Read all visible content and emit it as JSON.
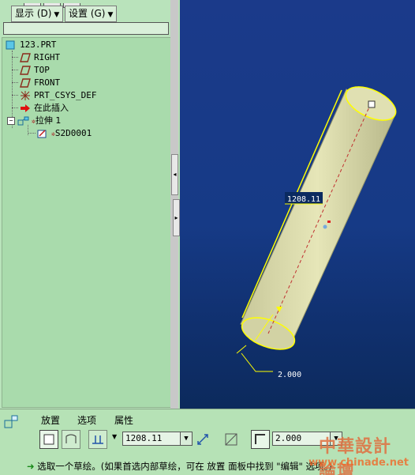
{
  "menubar": {
    "display": "显示 (D)",
    "settings": "设置 (G)"
  },
  "tree": {
    "root": "123.PRT",
    "items": [
      {
        "label": "RIGHT",
        "icon": "datum-plane-icon"
      },
      {
        "label": "TOP",
        "icon": "datum-plane-icon"
      },
      {
        "label": "FRONT",
        "icon": "datum-plane-icon"
      },
      {
        "label": "PRT_CSYS_DEF",
        "icon": "csys-icon"
      },
      {
        "label": "在此插入",
        "icon": "insert-here-arrow-icon"
      },
      {
        "label": "拉伸 1",
        "icon": "extrude-icon"
      },
      {
        "label": "S2D0001",
        "icon": "sketch-icon"
      }
    ]
  },
  "viewport": {
    "depth_label": "1208.11",
    "thickness_label": "2.000"
  },
  "dashboard": {
    "tabs": {
      "placement": "放置",
      "options": "选项",
      "properties": "属性"
    },
    "depth_value": "1208.11",
    "thickness_value": "2.000",
    "message": "选取一个草绘。(如果首选内部草绘，可在 放置 面板中找到 \"编辑\" 选项。)"
  },
  "watermark": {
    "line1": "中華設計論壇",
    "line2": "www.chinade.net"
  },
  "colors": {
    "tree_bg": "#a9dbac",
    "viewport_bg": "#163a86",
    "cylinder": "#d9d9a6",
    "highlight": "#ffff00"
  }
}
